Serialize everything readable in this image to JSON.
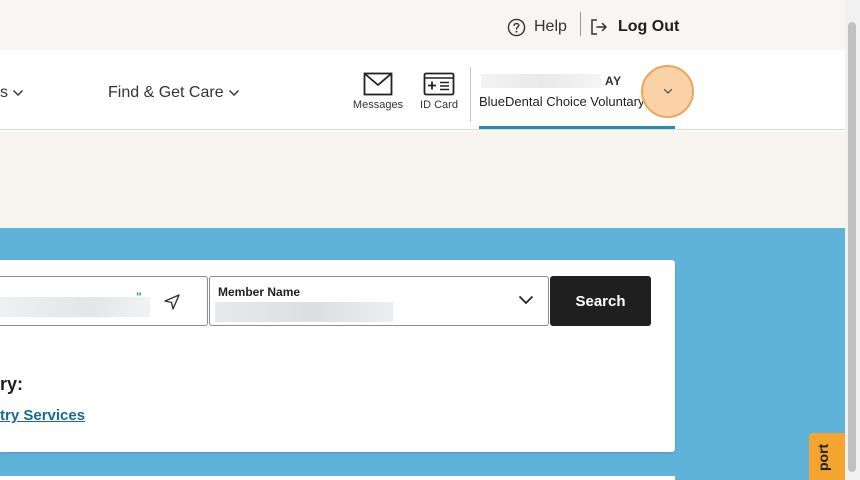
{
  "header": {
    "help_label": "Help",
    "logout_label": "Log Out"
  },
  "nav": {
    "partial_item_label": "s",
    "find_care_label": "Find & Get Care",
    "messages_label": "Messages",
    "id_card_label": "ID Card",
    "member_name_tail": "AY",
    "plan_name": "BlueDental Choice Voluntary"
  },
  "search": {
    "location_value_tail": "\"",
    "member_name_label": "Member Name",
    "search_button_label": "Search"
  },
  "categories": {
    "label_partial": "ry:",
    "link_partial": "try Services"
  },
  "support_tab_label": "port",
  "colors": {
    "topbar_bg": "#f9f5f2",
    "band_bg": "#f8f4f0",
    "panel_blue": "#5fb3d9",
    "accent_underline": "#2a8bb0",
    "search_button": "#1f1f1f",
    "link": "#1a6b8c",
    "highlight": "#f7ac60",
    "support_tab": "#f3a52f"
  }
}
